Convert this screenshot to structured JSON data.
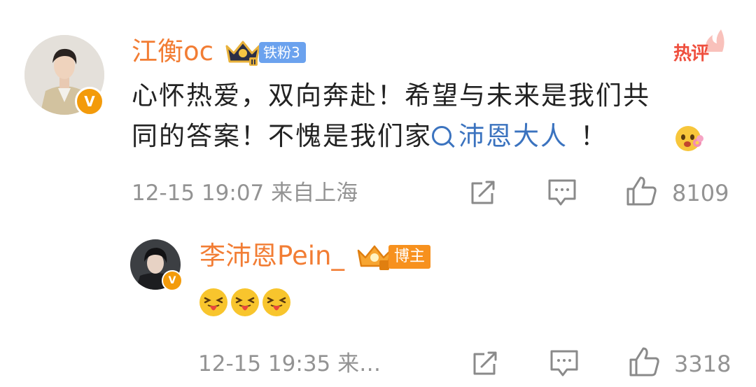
{
  "comment": {
    "username": "江衡oc",
    "fan_badge": "铁粉3",
    "hot_label": "热评",
    "text_line1": "心怀热爱，双向奔赴！希望与未来是我们共",
    "text_line2_before": "同的答案！不愧是我们家",
    "topic": "沛恩大人",
    "text_line2_after": "！",
    "meta": "12-15 19:07  来自上海",
    "like_count": "8109"
  },
  "reply": {
    "username": "李沛恩Pein_",
    "host_badge": "博主",
    "meta": "12-15 19:35  来…",
    "like_count": "3318"
  },
  "colors": {
    "username": "#f27d34",
    "link": "#3b73bf",
    "meta": "#939393",
    "hot": "#ef4f3e",
    "fan_badge": "#6ba2ee",
    "host_badge": "#f7911e"
  }
}
